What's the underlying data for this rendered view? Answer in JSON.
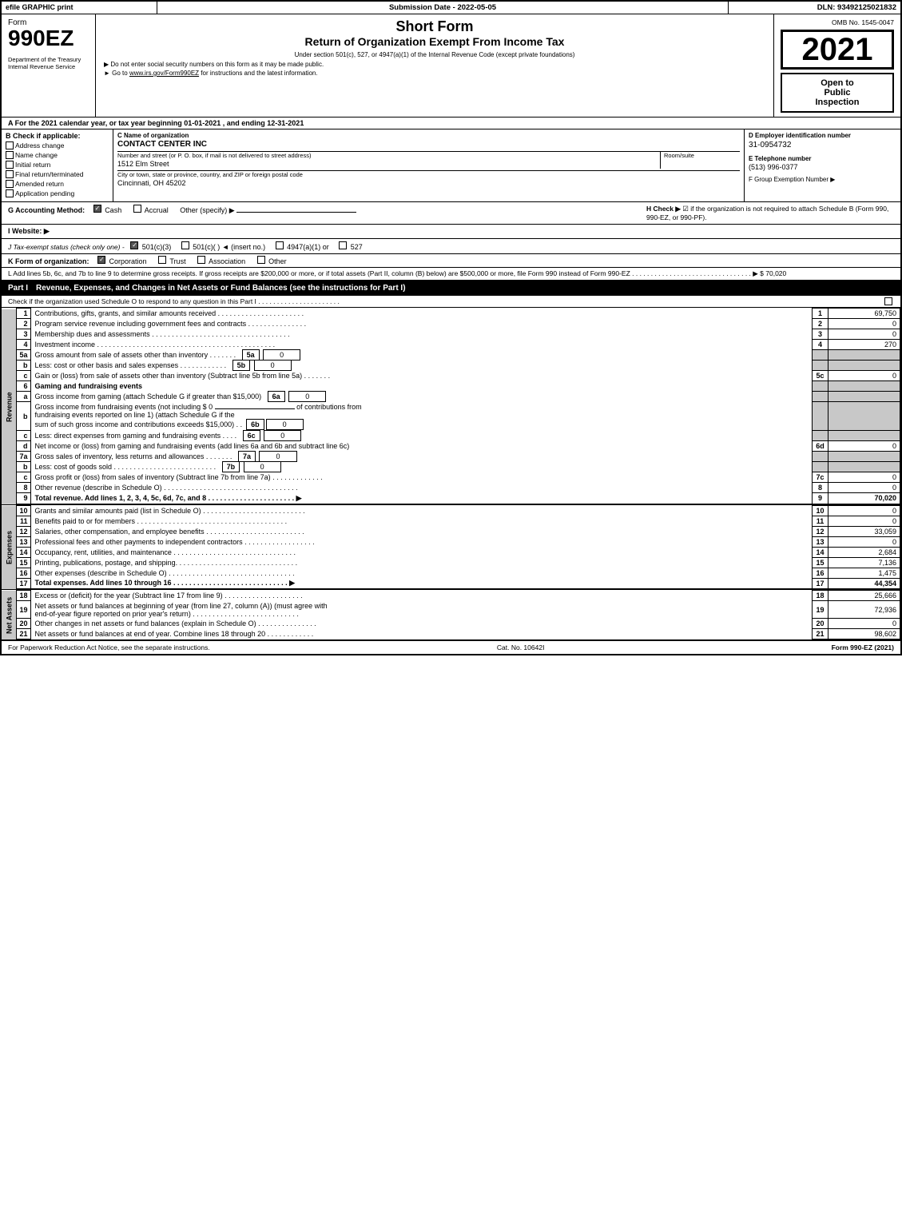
{
  "header": {
    "efile": "efile GRAPHIC print",
    "submission_label": "Submission Date - 2022-05-05",
    "dln_label": "DLN: 93492125021832"
  },
  "form": {
    "number": "990EZ",
    "title_line1": "Short Form",
    "title_line2": "Return of Organization Exempt From Income Tax",
    "subtitle": "Under section 501(c), 527, or 4947(a)(1) of the Internal Revenue Code (except private foundations)",
    "note1": "▶ Do not enter social security numbers on this form as it may be made public.",
    "note2": "▶ Go to www.irs.gov/Form990EZ for instructions and the latest information.",
    "year": "2021",
    "omb": "OMB No. 1545-0047",
    "dept": "Department of the Treasury Internal Revenue Service"
  },
  "open_public": {
    "line1": "Open to",
    "line2": "Public",
    "line3": "Inspection"
  },
  "section_a": {
    "text": "A For the 2021 calendar year, or tax year beginning 01-01-2021 , and ending 12-31-2021"
  },
  "section_b": {
    "label": "B Check if applicable:",
    "items": [
      {
        "label": "Address change",
        "checked": false
      },
      {
        "label": "Name change",
        "checked": false
      },
      {
        "label": "Initial return",
        "checked": false
      },
      {
        "label": "Final return/terminated",
        "checked": false
      },
      {
        "label": "Amended return",
        "checked": false
      },
      {
        "label": "Application pending",
        "checked": false
      }
    ]
  },
  "section_c": {
    "label": "C Name of organization",
    "org_name": "CONTACT CENTER INC",
    "address_label": "Number and street (or P. O. box, if mail is not delivered to street address)",
    "address": "1512 Elm Street",
    "room_label": "Room/suite",
    "room": "",
    "city_label": "City or town, state or province, country, and ZIP or foreign postal code",
    "city": "Cincinnati, OH  45202"
  },
  "section_d": {
    "ein_label": "D Employer identification number",
    "ein": "31-0954732",
    "phone_label": "E Telephone number",
    "phone": "(513) 996-0377",
    "group_label": "F Group Exemption Number",
    "group_symbol": "▶"
  },
  "accounting": {
    "label": "G Accounting Method:",
    "cash": "Cash",
    "accrual": "Accrual",
    "other": "Other (specify) ▶",
    "h_label": "H Check ▶",
    "h_text": "☑ if the organization is not required to attach Schedule B (Form 990, 990-EZ, or 990-PF)."
  },
  "website": {
    "label": "I Website: ▶"
  },
  "tax_exempt": {
    "label": "J Tax-exempt status (check only one) -",
    "options": [
      "☑ 501(c)(3)",
      "○ 501(c)( ) ◄ (insert no.)",
      "○ 4947(a)(1) or",
      "○ 527"
    ]
  },
  "k_section": {
    "label": "K Form of organization:",
    "options": [
      "☑ Corporation",
      "○ Trust",
      "○ Association",
      "○ Other"
    ]
  },
  "l_section": {
    "text": "L Add lines 5b, 6c, and 7b to line 9 to determine gross receipts. If gross receipts are $200,000 or more, or if total assets (Part II, column (B) below) are $500,000 or more, file Form 990 instead of Form 990-EZ . . . . . . . . . . . . . . . . . . . . . . . . . . . . . . . . ▶ $ 70,020"
  },
  "part1": {
    "header": "Part I",
    "title": "Revenue, Expenses, and Changes in Net Assets or Fund Balances (see the instructions for Part I)",
    "check_text": "Check if the organization used Schedule O to respond to any question in this Part I . . . . . . . . . . . . . . . . . . . . . .",
    "revenue_label": "Revenue",
    "expenses_label": "Expenses",
    "net_assets_label": "Net Assets",
    "rows": [
      {
        "num": "1",
        "desc": "Contributions, gifts, grants, and similar amounts received . . . . . . . . . . . . . . . . . . . . . .",
        "line": "1",
        "amount": "69,750",
        "shaded": false
      },
      {
        "num": "2",
        "desc": "Program service revenue including government fees and contracts . . . . . . . . . . . . . . .",
        "line": "2",
        "amount": "0",
        "shaded": false
      },
      {
        "num": "3",
        "desc": "Membership dues and assessments . . . . . . . . . . . . . . . . . . . . . . . . . . . . . . . . . . .",
        "line": "3",
        "amount": "0",
        "shaded": false
      },
      {
        "num": "4",
        "desc": "Investment income . . . . . . . . . . . . . . . . . . . . . . . . . . . . . . . . . . . . . . . . . . . . .",
        "line": "4",
        "amount": "270",
        "shaded": false
      }
    ],
    "row5a": {
      "desc": "Gross amount from sale of assets other than inventory . . . . . . .",
      "sub": "5a",
      "sub_amt": "0"
    },
    "row5b": {
      "desc": "Less: cost or other basis and sales expenses . . . . . . . . . . . .",
      "sub": "5b",
      "sub_amt": "0"
    },
    "row5c": {
      "desc": "Gain or (loss) from sale of assets other than inventory (Subtract line 5b from line 5a) . . . . . . .",
      "line": "5c",
      "amount": "0"
    },
    "row6_header": {
      "desc": "Gaming and fundraising events"
    },
    "row6a": {
      "desc": "Gross income from gaming (attach Schedule G if greater than $15,000)",
      "sub": "6a",
      "sub_amt": "0"
    },
    "row6b_desc1": "Gross income from fundraising events (not including $ 0",
    "row6b_desc2": "of contributions from",
    "row6b_desc3": "fundraising events reported on line 1) (attach Schedule G if the",
    "row6b_desc4": "sum of such gross income and contributions exceeds $15,000) . .",
    "row6b": {
      "sub": "6b",
      "sub_amt": "0"
    },
    "row6c": {
      "desc": "Less: direct expenses from gaming and fundraising events . . . .",
      "sub": "6c",
      "sub_amt": "0"
    },
    "row6d": {
      "desc": "Net income or (loss) from gaming and fundraising events (add lines 6a and 6b and subtract line 6c)",
      "line": "6d",
      "amount": "0"
    },
    "row7a": {
      "desc": "Gross sales of inventory, less returns and allowances . . . . . . .",
      "sub": "7a",
      "sub_amt": "0"
    },
    "row7b": {
      "desc": "Less: cost of goods sold . . . . . . . . . . . . . . . . . . . . . . . . . .",
      "sub": "7b",
      "sub_amt": "0"
    },
    "row7c": {
      "desc": "Gross profit or (loss) from sales of inventory (Subtract line 7b from line 7a) . . . . . . . . . . . . .",
      "line": "7c",
      "amount": "0"
    },
    "row8": {
      "desc": "Other revenue (describe in Schedule O) . . . . . . . . . . . . . . . . . . . . . . . . . . . . . . . . . .",
      "line": "8",
      "amount": "0"
    },
    "row9": {
      "desc": "Total revenue. Add lines 1, 2, 3, 4, 5c, 6d, 7c, and 8 . . . . . . . . . . . . . . . . . . . . . . ▶",
      "line": "9",
      "amount": "70,020",
      "bold": true
    },
    "row10": {
      "desc": "Grants and similar amounts paid (list in Schedule O) . . . . . . . . . . . . . . . . . . . . . . . . . .",
      "line": "10",
      "amount": "0"
    },
    "row11": {
      "desc": "Benefits paid to or for members . . . . . . . . . . . . . . . . . . . . . . . . . . . . . . . . . . . . . .",
      "line": "11",
      "amount": "0"
    },
    "row12": {
      "desc": "Salaries, other compensation, and employee benefits . . . . . . . . . . . . . . . . . . . . . . . . .",
      "line": "12",
      "amount": "33,059"
    },
    "row13": {
      "desc": "Professional fees and other payments to independent contractors . . . . . . . . . . . . . . . . . .",
      "line": "13",
      "amount": "0"
    },
    "row14": {
      "desc": "Occupancy, rent, utilities, and maintenance . . . . . . . . . . . . . . . . . . . . . . . . . . . . . . .",
      "line": "14",
      "amount": "2,684"
    },
    "row15": {
      "desc": "Printing, publications, postage, and shipping. . . . . . . . . . . . . . . . . . . . . . . . . . . . . . .",
      "line": "15",
      "amount": "7,136"
    },
    "row16": {
      "desc": "Other expenses (describe in Schedule O) . . . . . . . . . . . . . . . . . . . . . . . . . . . . . . . .",
      "line": "16",
      "amount": "1,475"
    },
    "row17": {
      "desc": "Total expenses. Add lines 10 through 16 . . . . . . . . . . . . . . . . . . . . . . . . . . . . . ▶",
      "line": "17",
      "amount": "44,354",
      "bold": true
    },
    "row18": {
      "desc": "Excess or (deficit) for the year (Subtract line 17 from line 9) . . . . . . . . . . . . . . . . . . . .",
      "line": "18",
      "amount": "25,666"
    },
    "row19_desc1": "Net assets or fund balances at beginning of year (from line 27, column (A)) (must agree with",
    "row19_desc2": "end-of-year figure reported on prior year's return) . . . . . . . . . . . . . . . . . . . . . . . . . . .",
    "row19": {
      "line": "19",
      "amount": "72,936"
    },
    "row20": {
      "desc": "Other changes in net assets or fund balances (explain in Schedule O) . . . . . . . . . . . . . . .",
      "line": "20",
      "amount": "0"
    },
    "row21": {
      "desc": "Net assets or fund balances at end of year. Combine lines 18 through 20 . . . . . . . . . . . .",
      "line": "21",
      "amount": "98,602"
    }
  },
  "footer": {
    "left": "For Paperwork Reduction Act Notice, see the separate instructions.",
    "cat": "Cat. No. 10642I",
    "right": "Form 990-EZ (2021)"
  }
}
